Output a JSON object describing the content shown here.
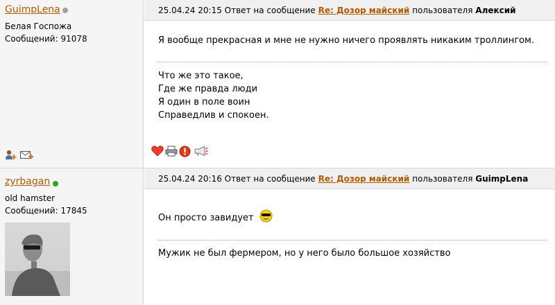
{
  "posts": [
    {
      "username": "GuimpLena",
      "status_color": "#a0a0a0",
      "user_title": "Белая Госпожа",
      "messages_label": "Сообщений:",
      "messages_count": "91078",
      "datetime": "25.04.24 20:15",
      "reply_prefix": "Ответ на сообщение",
      "reply_subject": "Re: Дозор майский",
      "reply_user_prefix": "пользователя",
      "reply_user": "Алексий",
      "body": "Я вообще прекрасная и мне не нужно ничего проявлять никаким троллингом.",
      "signature": [
        "Что же это такое,",
        "Где же правда люди",
        "Я один в поле воин",
        "Справедлив и спокоен."
      ],
      "action_icons": [
        "heart-icon",
        "printer-icon",
        "alert-icon",
        "megaphone-icon"
      ],
      "profile_icons": [
        "add-friend-icon",
        "send-message-icon"
      ]
    },
    {
      "username": "zyrbagan",
      "status_color": "#22aa22",
      "user_title": "old hamster",
      "messages_label": "Сообщений:",
      "messages_count": "17845",
      "datetime": "25.04.24 20:16",
      "reply_prefix": "Ответ на сообщение",
      "reply_subject": "Re: Дозор майский",
      "reply_user_prefix": "пользователя",
      "reply_user": "GuimpLena",
      "body": "Он просто завидует",
      "emoji": "sunglasses-smiley-icon",
      "signature": [
        "Мужик не был фермером, но у него было большое хозяйство"
      ]
    }
  ]
}
